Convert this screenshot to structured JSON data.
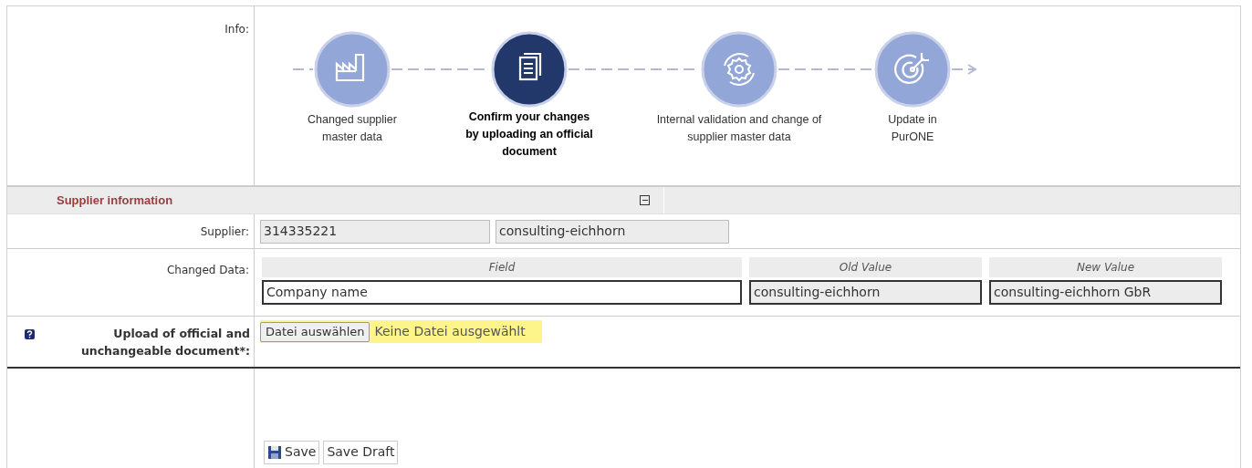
{
  "info": {
    "label": "Info:",
    "steps": [
      {
        "kind": "factory",
        "label": "Changed supplier master data",
        "selected": false
      },
      {
        "kind": "document",
        "label": "Confirm your changes by uploading an official document",
        "selected": true
      },
      {
        "kind": "gear",
        "label": "Internal validation and change of supplier master data",
        "selected": false
      },
      {
        "kind": "target",
        "label": "Update in PurONE",
        "selected": false
      }
    ]
  },
  "section": {
    "title": "Supplier information",
    "expanded": true
  },
  "supplier": {
    "label": "Supplier:",
    "number": "314335221",
    "name": "consulting-eichhorn"
  },
  "changed_data": {
    "label": "Changed Data:",
    "columns": [
      "Field",
      "Old Value",
      "New Value"
    ],
    "rows": [
      {
        "field": "Company name",
        "old_value": "consulting-eichhorn",
        "new_value": "consulting-eichhorn GbR"
      }
    ]
  },
  "upload": {
    "label": "Upload of official and unchangeable document*:",
    "button": "Datei auswählen",
    "status": "Keine Datei ausgewählt"
  },
  "buttons": [
    {
      "kind": "save",
      "label": "Save"
    },
    {
      "kind": "plain",
      "label": "Save Draft"
    }
  ]
}
